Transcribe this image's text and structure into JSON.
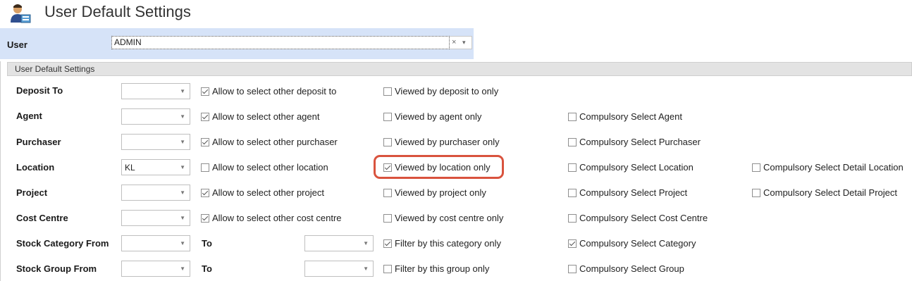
{
  "window": {
    "title": "User Default Settings"
  },
  "user": {
    "label": "User",
    "value": "ADMIN",
    "clear_glyph": "×",
    "dropdown_glyph": "▾"
  },
  "group": {
    "title": "User Default Settings"
  },
  "rows": [
    {
      "label": "Deposit To",
      "combo_value": "",
      "allow": {
        "label": "Allow to select other deposit to",
        "checked": true
      },
      "viewed": {
        "label": "Viewed by deposit to only",
        "checked": false
      }
    },
    {
      "label": "Agent",
      "combo_value": "",
      "allow": {
        "label": "Allow to select other agent",
        "checked": true
      },
      "viewed": {
        "label": "Viewed by agent only",
        "checked": false
      },
      "compulsory": {
        "label": "Compulsory Select Agent",
        "checked": false
      }
    },
    {
      "label": "Purchaser",
      "combo_value": "",
      "allow": {
        "label": "Allow to select other purchaser",
        "checked": true
      },
      "viewed": {
        "label": "Viewed by purchaser only",
        "checked": false
      },
      "compulsory": {
        "label": "Compulsory Select Purchaser",
        "checked": false
      }
    },
    {
      "label": "Location",
      "combo_value": "KL",
      "allow": {
        "label": "Allow to select other location",
        "checked": false
      },
      "viewed": {
        "label": "Viewed by location only",
        "checked": true
      },
      "compulsory": {
        "label": "Compulsory Select Location",
        "checked": false
      },
      "detail": {
        "label": "Compulsory Select Detail Location",
        "checked": false
      }
    },
    {
      "label": "Project",
      "combo_value": "",
      "allow": {
        "label": "Allow to select other project",
        "checked": true
      },
      "viewed": {
        "label": "Viewed by project only",
        "checked": false
      },
      "compulsory": {
        "label": "Compulsory Select Project",
        "checked": false
      },
      "detail": {
        "label": "Compulsory Select Detail Project",
        "checked": false
      }
    },
    {
      "label": "Cost Centre",
      "combo_value": "",
      "allow": {
        "label": "Allow to select other cost centre",
        "checked": true
      },
      "viewed": {
        "label": "Viewed by cost centre only",
        "checked": false
      },
      "compulsory": {
        "label": "Compulsory Select Cost Centre",
        "checked": false
      }
    },
    {
      "label": "Stock Category From",
      "combo_value": "",
      "to_label": "To",
      "to_value": "",
      "viewed": {
        "label": "Filter by this category only",
        "checked": true
      },
      "compulsory": {
        "label": "Compulsory Select Category",
        "checked": true
      }
    },
    {
      "label": "Stock Group From",
      "combo_value": "",
      "to_label": "To",
      "to_value": "",
      "viewed": {
        "label": "Filter by this group only",
        "checked": false
      },
      "compulsory": {
        "label": "Compulsory Select Group",
        "checked": false
      }
    }
  ],
  "icons": {
    "title_icon": "user-settings-icon",
    "dropdown_icon": "chevron-down-icon"
  },
  "colors": {
    "user_band": "#d6e3f8",
    "highlight": "#d9533e",
    "group_header": "#e3e3e3"
  }
}
